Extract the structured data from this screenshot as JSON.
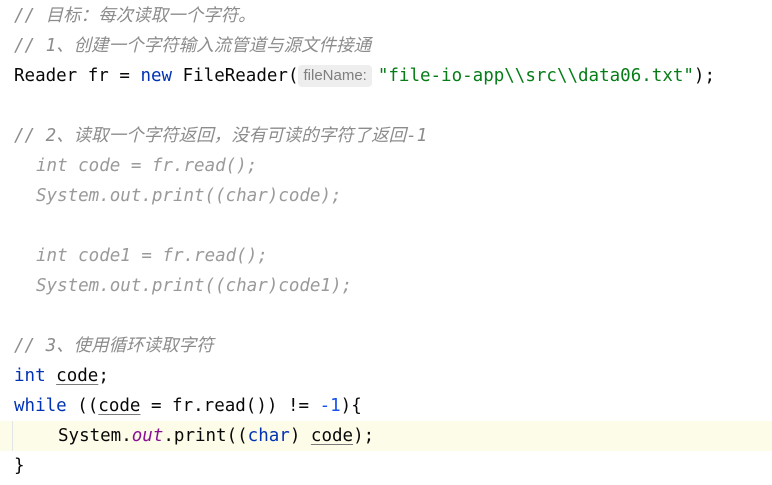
{
  "code": {
    "l1_comment": "// 目标：每次读取一个字符。",
    "l2_comment": "// 1、创建一个字符输入流管道与源文件接通",
    "l3": {
      "type": "Reader",
      "var": " fr = ",
      "kw_new": "new",
      "ctor": " FileReader(",
      "hint": "fileName:",
      "str": "\"file-io-app\\\\src\\\\data06.txt\"",
      "end": ");"
    },
    "l5_comment": "// 2、读取一个字符返回，没有可读的字符了返回-1",
    "l6": "int code = fr.read();",
    "l7": "System.out.print((char)code);",
    "l9": "int code1 = fr.read();",
    "l10": "System.out.print((char)code1);",
    "l12_comment": "// 3、使用循环读取字符",
    "l13": {
      "kw": "int",
      "sp": " ",
      "var": "code",
      "end": ";"
    },
    "l14": {
      "kw": "while",
      "a": " ((",
      "var": "code",
      "b": " = fr.read()) != ",
      "num": "-1",
      "c": "){"
    },
    "l15": {
      "a": "System.",
      "field": "out",
      "b": ".print((",
      "kw": "char",
      "c": ") ",
      "var": "code",
      "d": ");"
    },
    "l16": "}"
  },
  "colors": {
    "keyword": "#0033b3",
    "string": "#067d17",
    "number": "#1750eb",
    "comment": "#8c8c8c",
    "field": "#871094"
  }
}
